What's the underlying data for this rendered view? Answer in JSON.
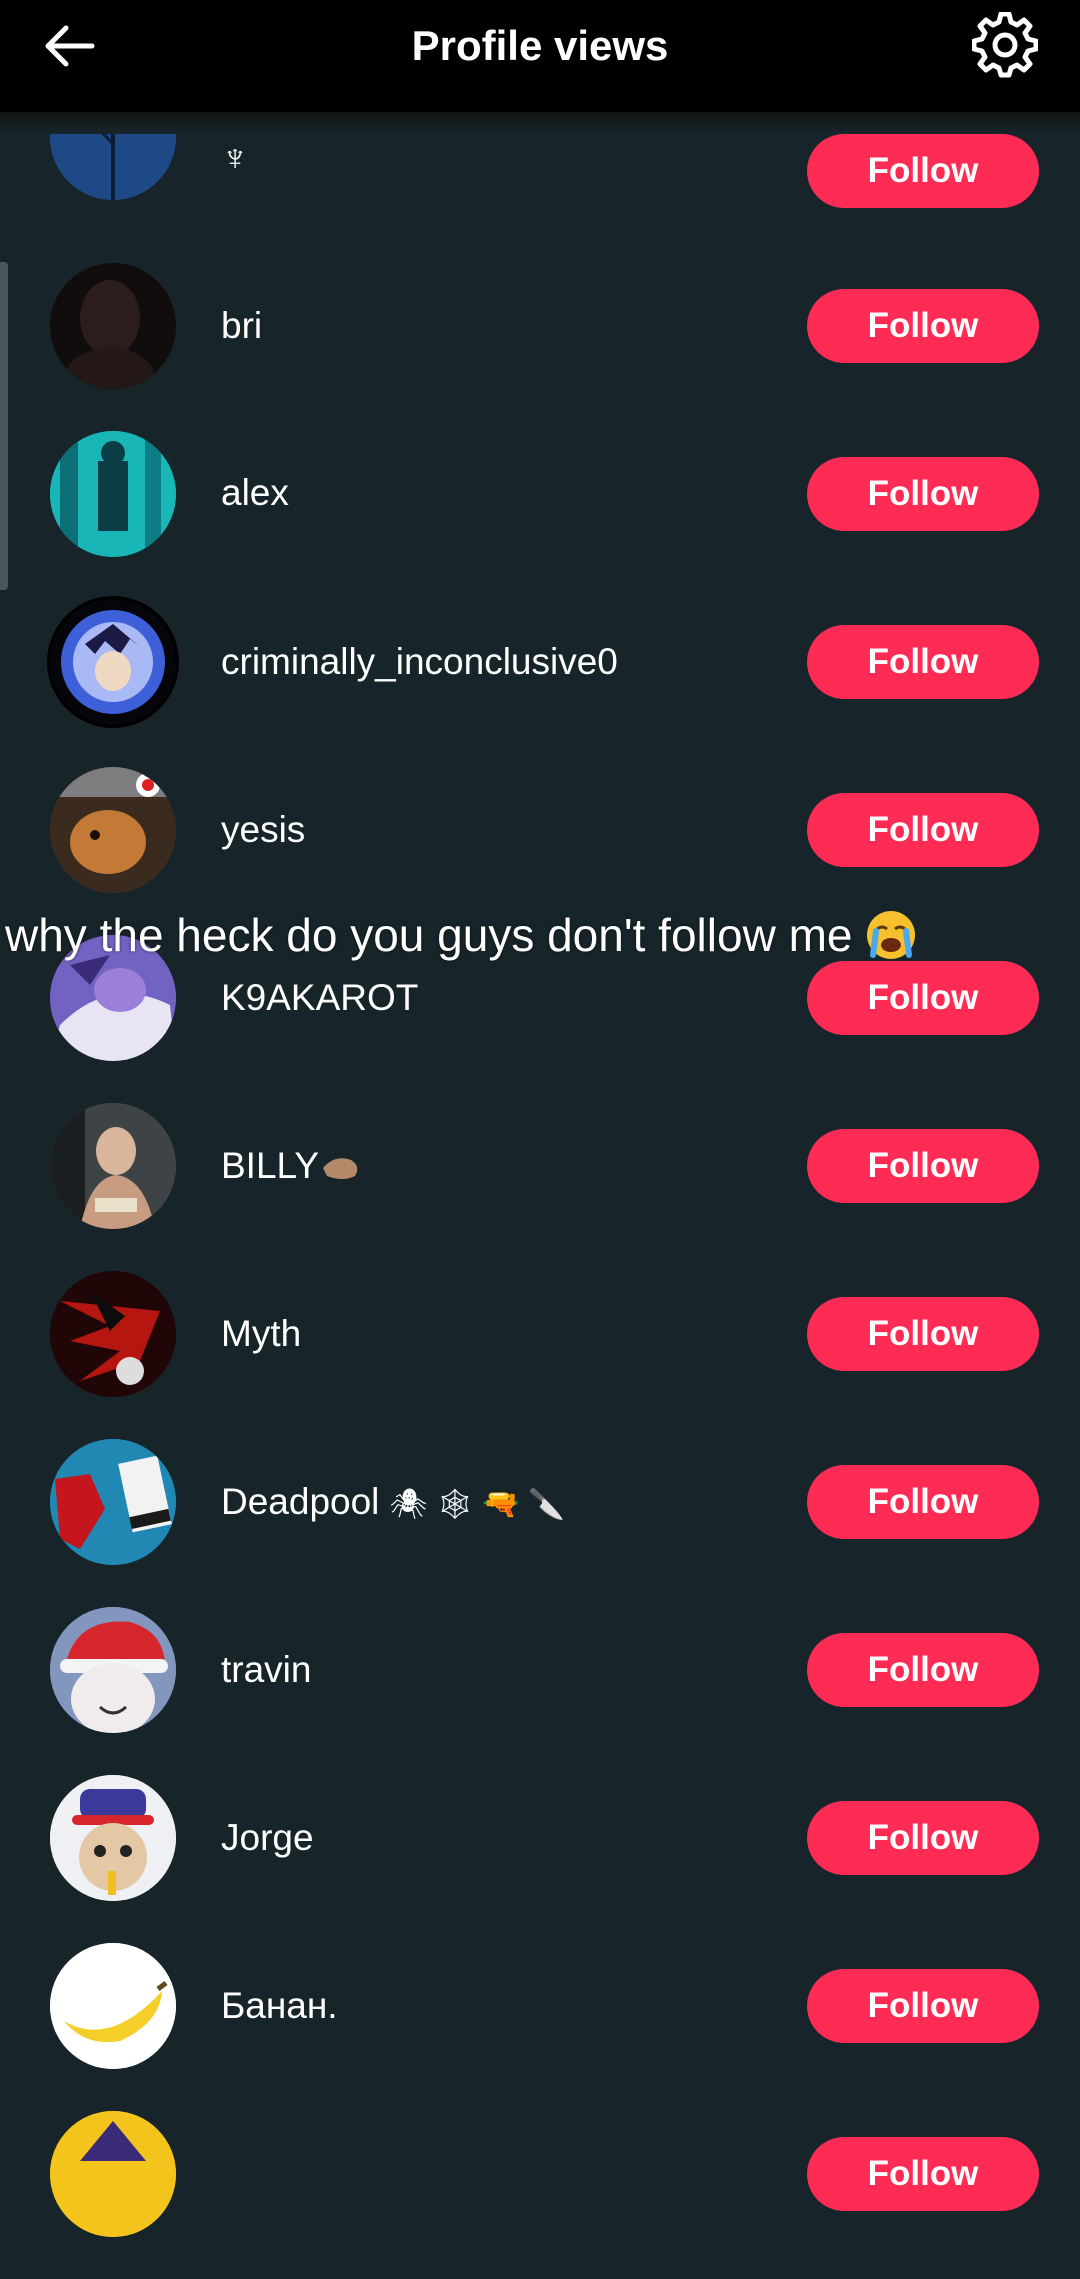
{
  "header": {
    "title": "Profile views",
    "back_icon": "arrow-left-icon",
    "settings_icon": "gear-icon"
  },
  "overlay": {
    "caption": "why the heck do you guys don't follow me",
    "caption_emoji": "loudly-crying-face"
  },
  "follow_label": "Follow",
  "colors": {
    "background": "#17252b",
    "header": "#000000",
    "follow_button": "#fe2c55",
    "text": "#ffffff"
  },
  "users": [
    {
      "name": "♆",
      "avatar": "dark blue tree silhouette"
    },
    {
      "name": "bri",
      "avatar": "dark portrait"
    },
    {
      "name": "alex",
      "avatar": "teal mirror selfie"
    },
    {
      "name": "criminally_inconclusive0",
      "avatar": "anime character"
    },
    {
      "name": "yesis",
      "avatar": "hamster"
    },
    {
      "name": "K9AKAROT",
      "avatar": "anime character purple"
    },
    {
      "name": "BILLY",
      "avatar": "child portrait",
      "emoji": "brown hand"
    },
    {
      "name": "Myth",
      "avatar": "dark red character"
    },
    {
      "name": "Deadpool",
      "avatar": "deadpool comic",
      "emoji": "🕷 🕸 🔫 🔪"
    },
    {
      "name": "travin",
      "avatar": "cartoon santa hat"
    },
    {
      "name": "Jorge",
      "avatar": "kitten with hat"
    },
    {
      "name": "Банан.",
      "avatar": "banana"
    },
    {
      "name": "",
      "avatar": "cartoon partial"
    }
  ]
}
